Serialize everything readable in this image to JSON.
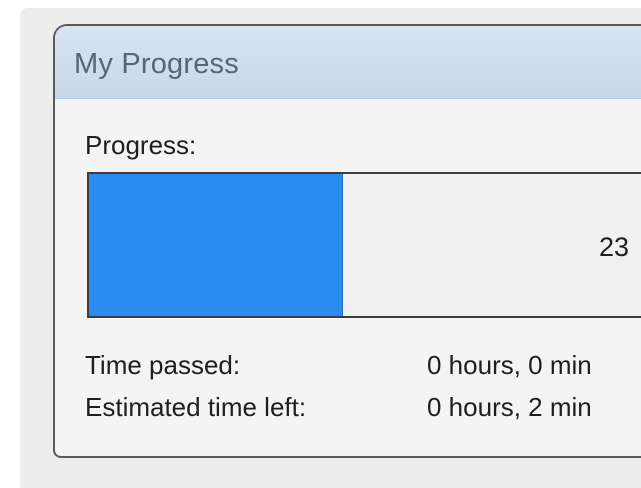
{
  "window": {
    "title": "My Progress"
  },
  "progress": {
    "label": "Progress:",
    "percent_text": "23",
    "fraction": 0.23
  },
  "info": {
    "time_passed_label": "Time passed:",
    "time_passed_value": "0 hours, 0 min",
    "time_left_label": "Estimated time left:",
    "time_left_value": "0 hours, 2 min"
  },
  "colors": {
    "progress_fill": "#2b8cf0",
    "titlebar": "#d6e4f2"
  }
}
